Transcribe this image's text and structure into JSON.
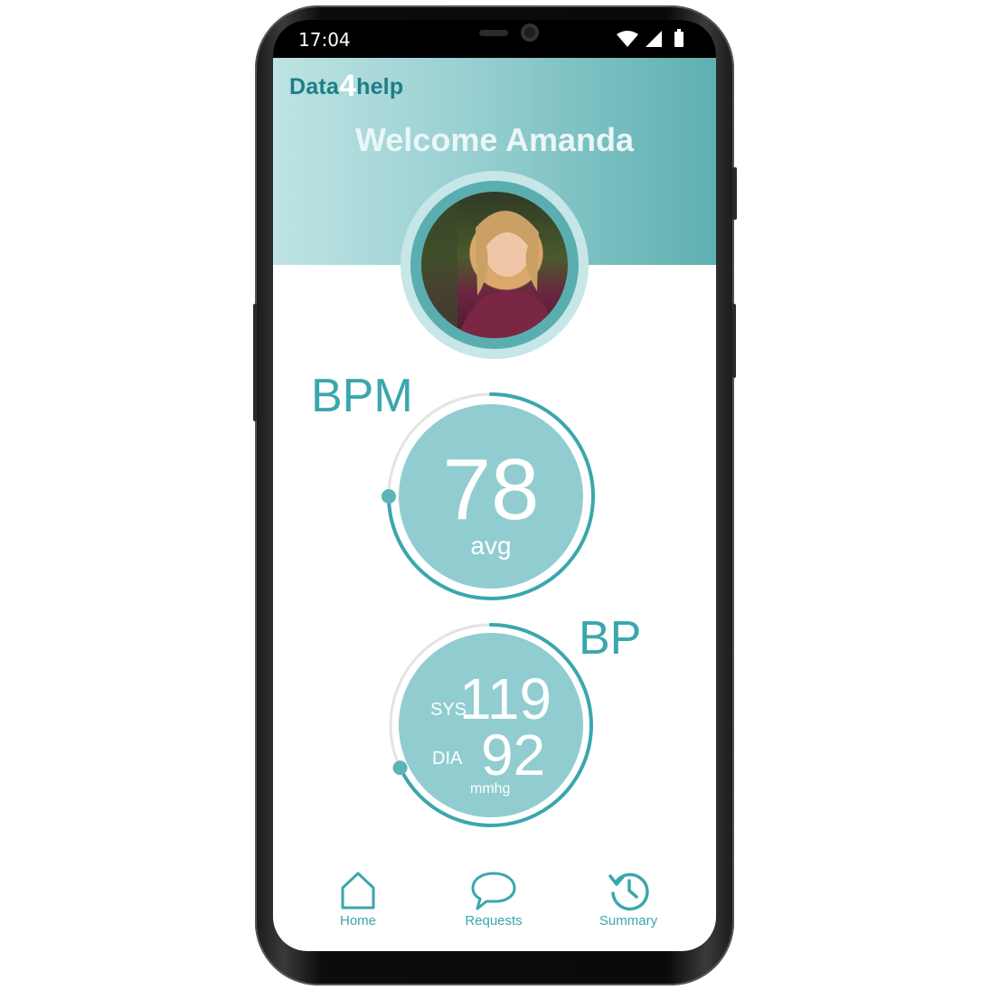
{
  "status": {
    "time": "17:04"
  },
  "app": {
    "logo_left": "Data",
    "logo_num": "4",
    "logo_right": "help"
  },
  "header": {
    "welcome": "Welcome Amanda"
  },
  "bpm": {
    "label": "BPM",
    "value": "78",
    "unit": "avg",
    "progress": 0.75
  },
  "bp": {
    "label": "BP",
    "sys_label": "SYS",
    "sys_value": "119",
    "dia_label": "DIA",
    "dia_value": "92",
    "unit": "mmhg",
    "progress": 0.68
  },
  "nav": {
    "items": [
      {
        "label": "Home",
        "icon": "home-icon"
      },
      {
        "label": "Requests",
        "icon": "chat-icon"
      },
      {
        "label": "Summary",
        "icon": "history-icon"
      }
    ]
  },
  "colors": {
    "accent": "#3aa7ad",
    "circle_fill": "#91cdd0",
    "track": "#e4e4e4"
  }
}
